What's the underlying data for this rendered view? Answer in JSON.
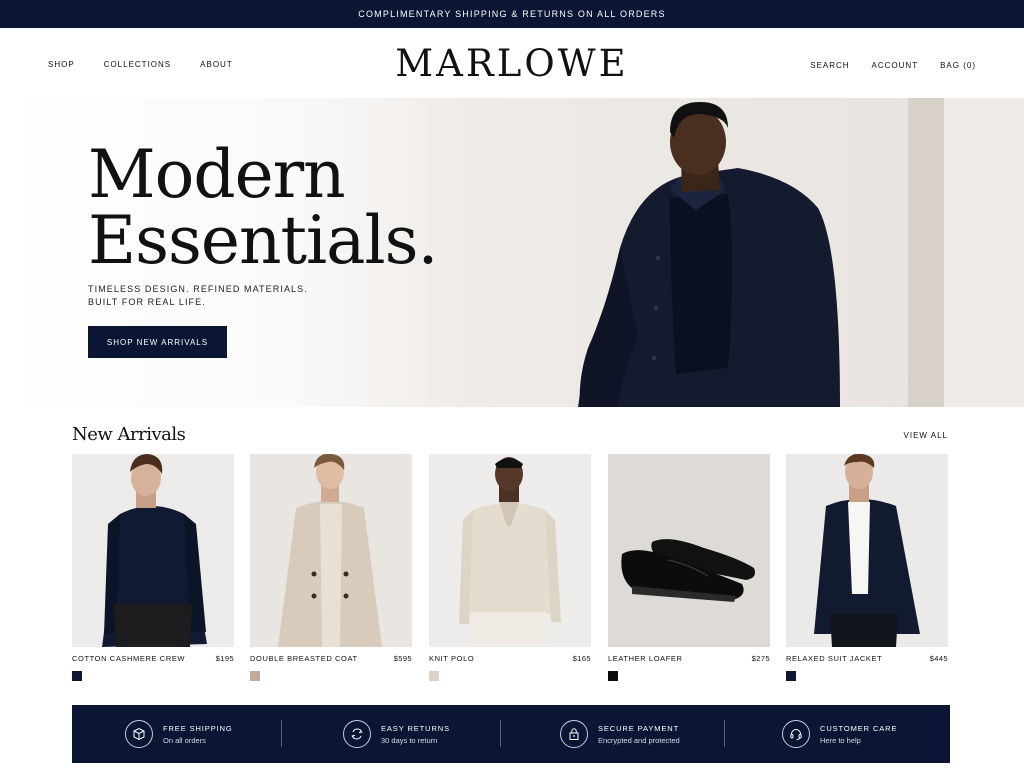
{
  "promo": {
    "text": "COMPLIMENTARY SHIPPING & RETURNS ON ALL ORDERS"
  },
  "header": {
    "logo": "MARLOWE",
    "nav_left": [
      "SHOP",
      "COLLECTIONS",
      "ABOUT"
    ],
    "nav_right": [
      "SEARCH",
      "ACCOUNT",
      "BAG (0)"
    ]
  },
  "hero": {
    "title_line1": "Modern",
    "title_line2": "Essentials.",
    "subtitle_line1": "TIMELESS DESIGN. REFINED MATERIALS.",
    "subtitle_line2": "BUILT FOR REAL LIFE.",
    "cta": "SHOP NEW ARRIVALS"
  },
  "new_arrivals": {
    "title": "New Arrivals",
    "view_all": "VIEW ALL",
    "products": [
      {
        "name": "COTTON CASHMERE CREW",
        "price": "$195",
        "swatch": "#0e1833"
      },
      {
        "name": "DOUBLE BREASTED COAT",
        "price": "$595",
        "swatch": "#bfab99"
      },
      {
        "name": "KNIT POLO",
        "price": "$165",
        "swatch": "#ddd3c6"
      },
      {
        "name": "LEATHER LOAFER",
        "price": "$275",
        "swatch": "#0a0a0a"
      },
      {
        "name": "RELAXED SUIT JACKET",
        "price": "$445",
        "swatch": "#0e1833"
      }
    ]
  },
  "features": [
    {
      "icon": "box-icon",
      "title": "FREE SHIPPING",
      "desc": "On all orders"
    },
    {
      "icon": "returns-icon",
      "title": "EASY RETURNS",
      "desc": "30 days to return"
    },
    {
      "icon": "lock-icon",
      "title": "SECURE PAYMENT",
      "desc": "Encrypted and protected"
    },
    {
      "icon": "headset-icon",
      "title": "CUSTOMER CARE",
      "desc": "Here to help"
    }
  ],
  "colors": {
    "navy": "#0b1634",
    "accent_text": "#111111"
  }
}
